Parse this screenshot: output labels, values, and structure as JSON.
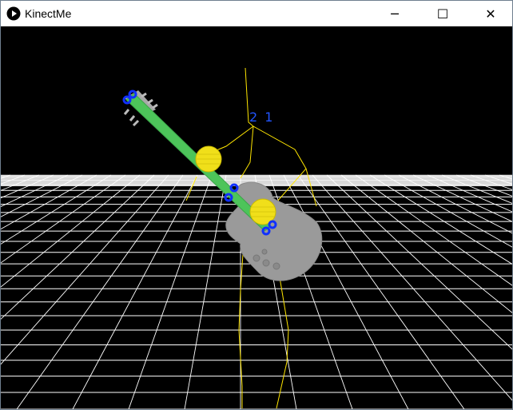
{
  "window": {
    "title": "KinectMe",
    "controls": {
      "minimize_glyph": "─",
      "maximize_glyph": "☐",
      "close_glyph": "✕"
    }
  },
  "scene": {
    "body_id_label": "2 1",
    "colors": {
      "background": "#000000",
      "floor_grid": "#ffffff",
      "skeleton": "#ffe600",
      "guitar_body": "#9a9a9a",
      "guitar_neck": "#4dc45a",
      "joint_marker": "#1030ff",
      "hand_sphere": "#ffe600"
    }
  }
}
